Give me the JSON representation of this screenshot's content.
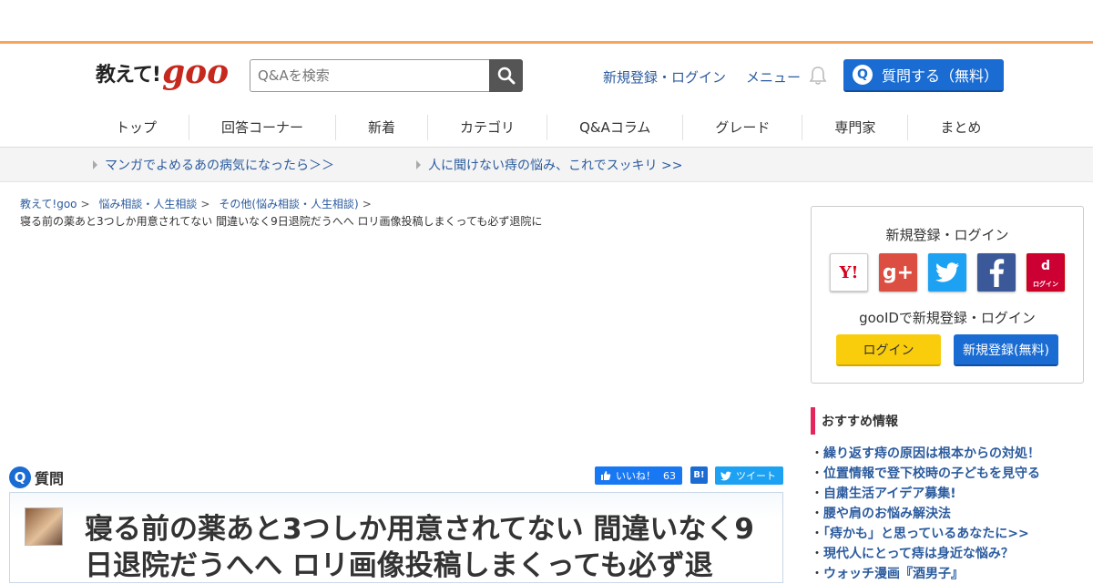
{
  "header": {
    "logo_text": "教えて!",
    "logo_brand": "goo",
    "search_placeholder": "Q&Aを検索",
    "links": [
      "新規登録・ログイン",
      "メニュー"
    ],
    "ask_button": "質問する（無料）",
    "ask_icon": "Q"
  },
  "nav": {
    "items": [
      "トップ",
      "回答コーナー",
      "新着",
      "カテゴリ",
      "Q&Aコラム",
      "グレード",
      "専門家",
      "まとめ"
    ]
  },
  "promo": {
    "items": [
      "マンガでよめるあの病気になったら＞＞",
      "人に聞けない痔の悩み、これでスッキリ >>"
    ]
  },
  "breadcrumb": {
    "items": [
      "教えて!goo",
      "悩み相談・人生相談",
      "その他(悩み相談・人生相談)"
    ],
    "sep": ">",
    "current": "寝る前の薬あと3つしか用意されてない 間違いなく9日退院だうへへ ロリ画像投稿しまくっても必ず退院に"
  },
  "question": {
    "label": "質問",
    "icon": "Q",
    "like_label": "いいね！",
    "like_count": "63",
    "hatena_label": "B!",
    "tweet_label": "ツイート",
    "title": "寝る前の薬あと3つしか用意されてない 間違いなく9日退院だうへへ ロリ画像投稿しまくっても必ず退"
  },
  "sidebar": {
    "login_title": "新規登録・ログイン",
    "yahoo": "Y!",
    "google": "g+",
    "docomo_top": "d",
    "docomo_bot": "ログイン",
    "gooid_text": "gooIDで新規登録・ログイン",
    "login_button": "ログイン",
    "register_button": "新規登録(無料)",
    "rec_title": "おすすめ情報",
    "rec_items": [
      "繰り返す痔の原因は根本からの対処！",
      "位置情報で登下校時の子どもを見守る",
      "自粛生活アイデア募集!",
      "腰や肩のお悩み解決法",
      "「痔かも」と思っているあなたに>>",
      "現代人にとって痔は身近な悩み？",
      "ウォッチ漫画『酒男子』"
    ]
  }
}
